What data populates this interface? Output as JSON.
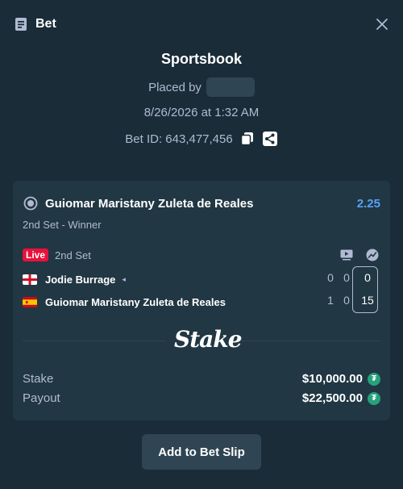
{
  "header": {
    "title": "Bet",
    "title_icon": "receipt-icon",
    "close_icon": "close-icon"
  },
  "meta": {
    "title": "Sportsbook",
    "placed_by_label": "Placed by",
    "date": "8/26/2026 at 1:32 AM",
    "bet_id": "Bet ID: 643,477,456"
  },
  "selection": {
    "name": "Guiomar Maristany Zuleta de Reales",
    "odds": "2.25",
    "market": "2nd Set - Winner",
    "icon": "tennis-ball-icon"
  },
  "live": {
    "badge": "Live",
    "status": "2nd Set"
  },
  "match": {
    "teams": [
      {
        "name": "Jodie Burrage",
        "serving": true,
        "serve_marker": "◂",
        "flag": "england-flag",
        "sets": "0",
        "games": "0",
        "points": "0"
      },
      {
        "name": "Guiomar Maristany Zuleta de Reales",
        "serving": false,
        "flag": "spain-flag",
        "sets": "1",
        "games": "0",
        "points": "15"
      }
    ]
  },
  "brand": {
    "logo_text": "Stake"
  },
  "summary": {
    "stake_label": "Stake",
    "stake_value": "$10,000.00",
    "payout_label": "Payout",
    "payout_value": "$22,500.00",
    "currency_icon": "tether-icon",
    "currency_symbol": "₮"
  },
  "actions": {
    "add_to_slip": "Add to Bet Slip"
  },
  "colors": {
    "background": "#1a2c38",
    "card": "#213743",
    "odds": "#5aa0f5",
    "live": "#e9113c",
    "currency": "#26a17b",
    "muted_text": "#b1bad3"
  }
}
